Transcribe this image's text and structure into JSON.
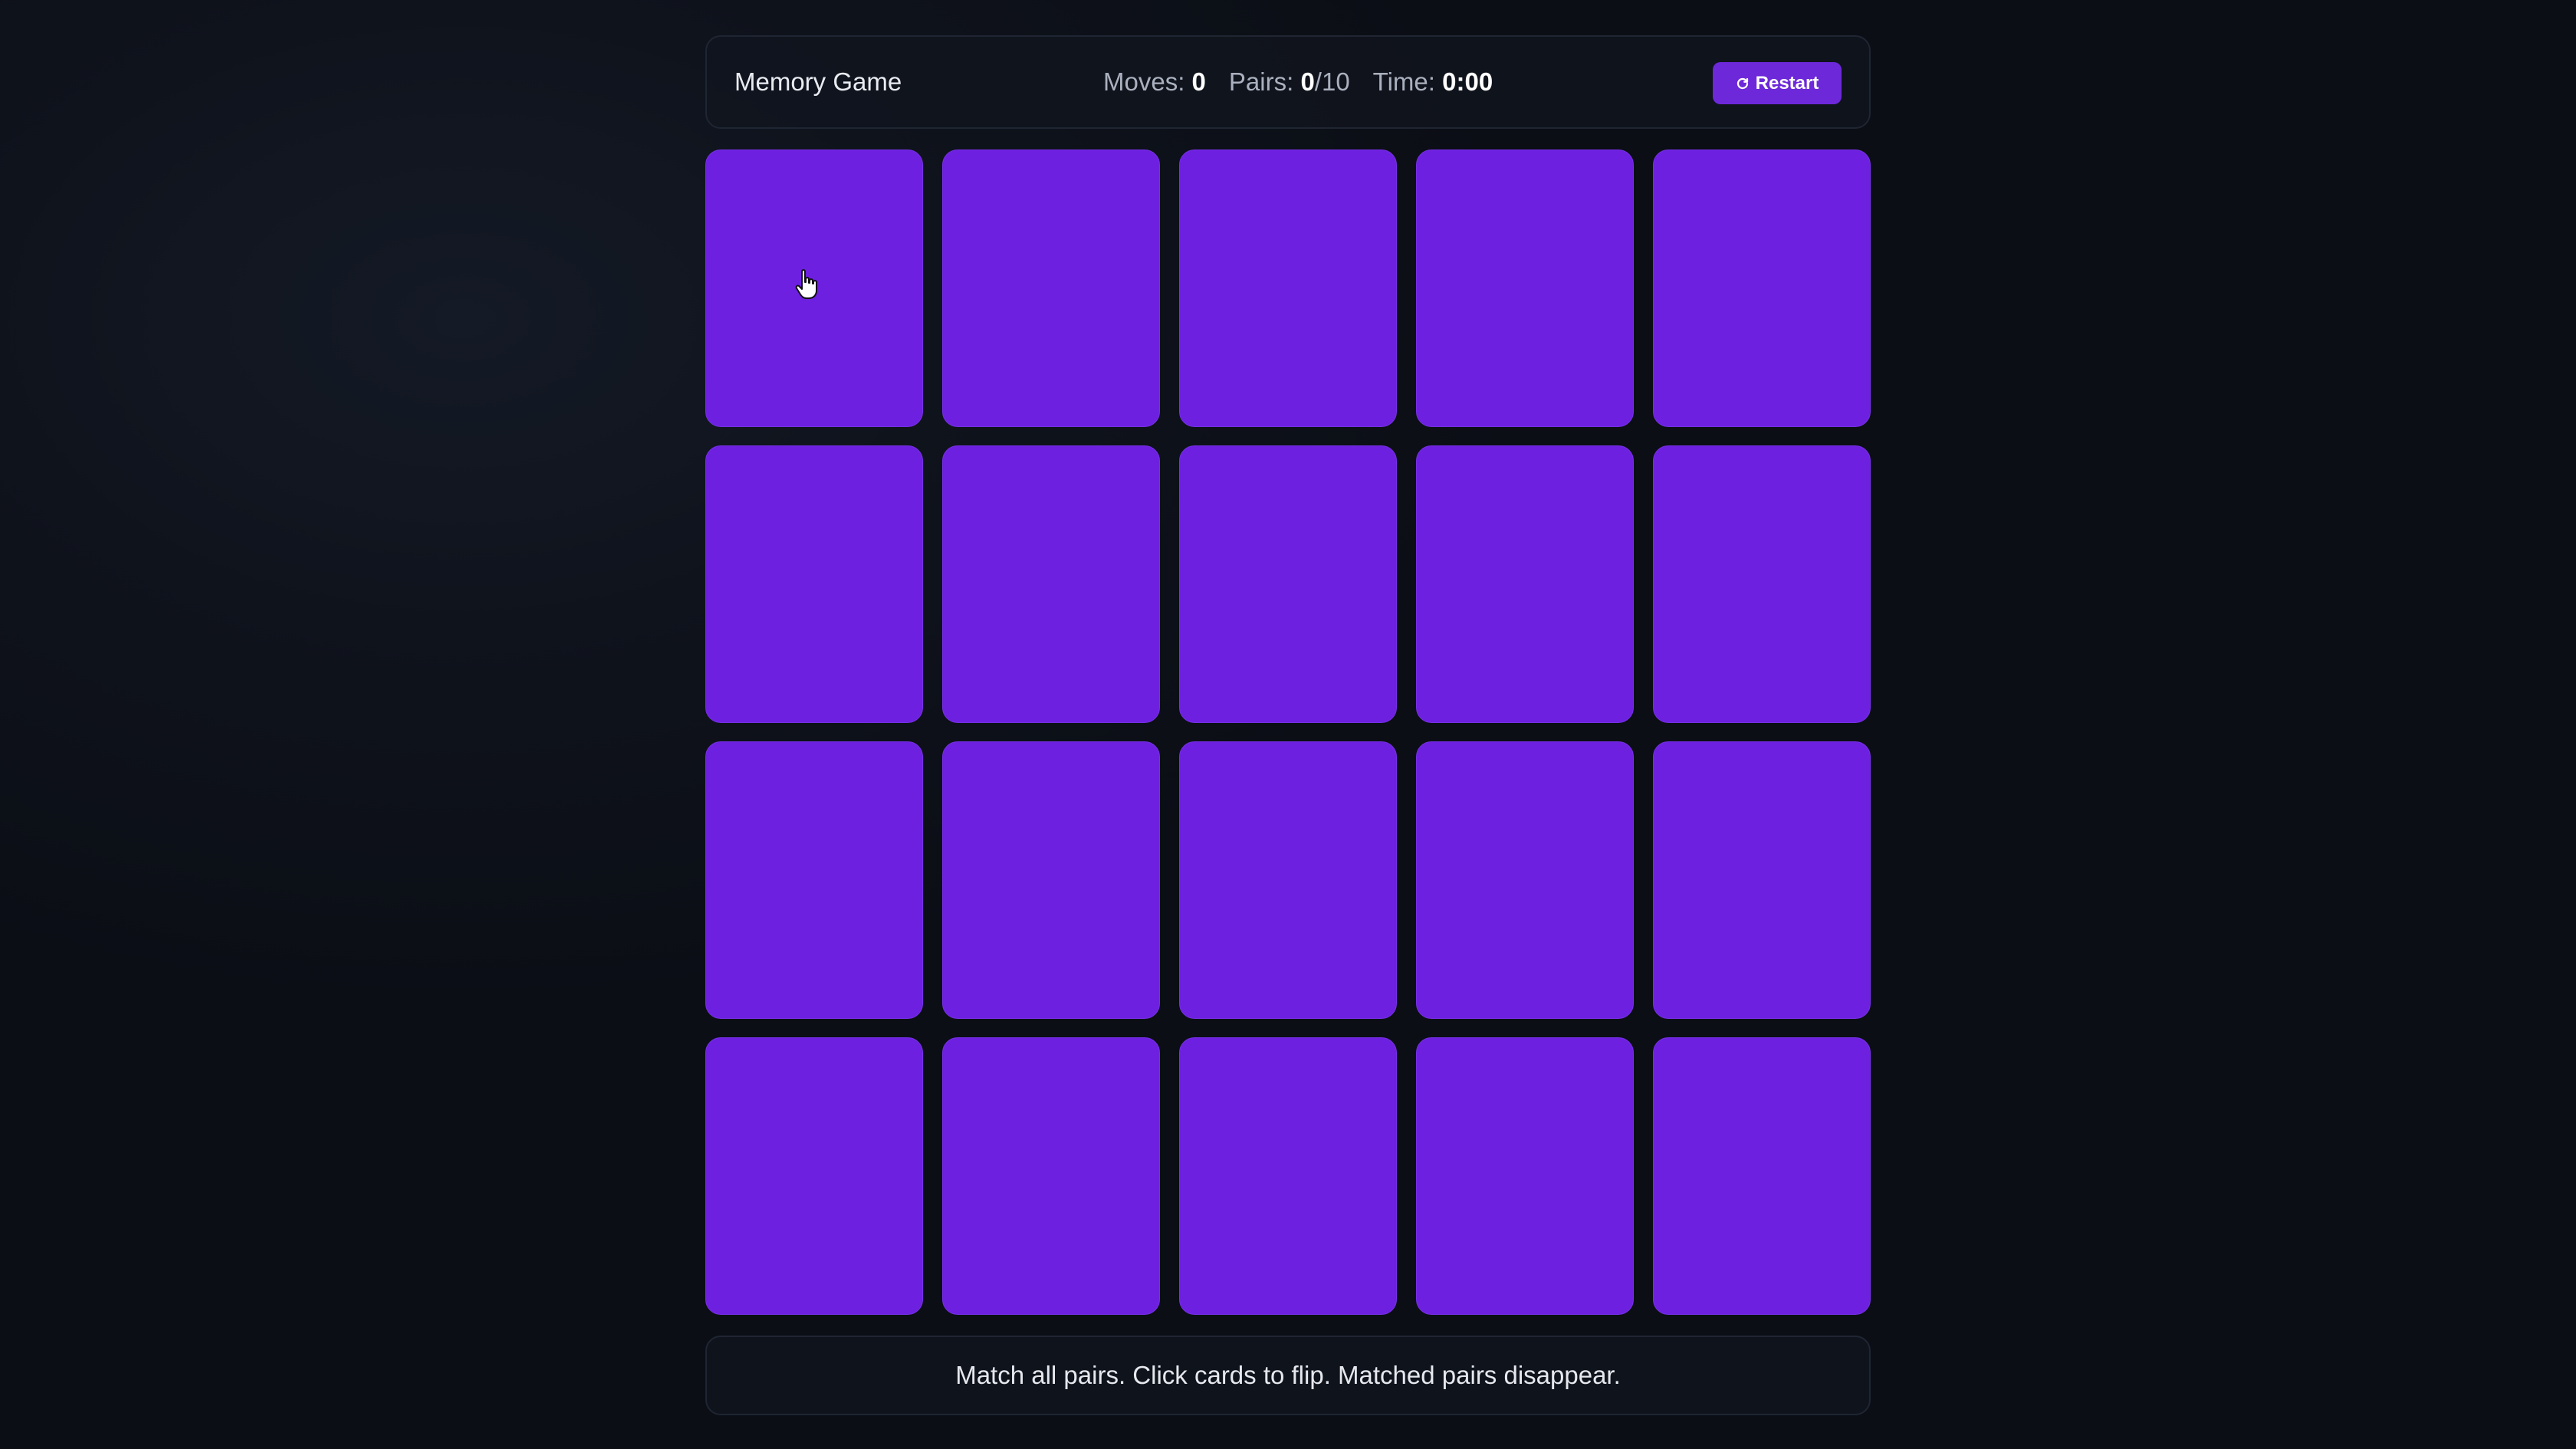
{
  "header": {
    "title": "Memory Game",
    "moves_label": "Moves:",
    "moves_value": "0",
    "pairs_label": "Pairs:",
    "pairs_value": "0",
    "pairs_total": "/10",
    "time_label": "Time:",
    "time_value": "0:00",
    "restart_label": "Restart",
    "restart_icon": "refresh-icon"
  },
  "board": {
    "columns": 5,
    "rows": 4,
    "card_count": 20,
    "card_state": "face-down",
    "card_color": "#6d20e0"
  },
  "footer": {
    "instructions": "Match all pairs. Click cards to flip. Matched pairs disappear."
  },
  "colors": {
    "accent": "#6d28d9",
    "background": "#0f131c"
  }
}
